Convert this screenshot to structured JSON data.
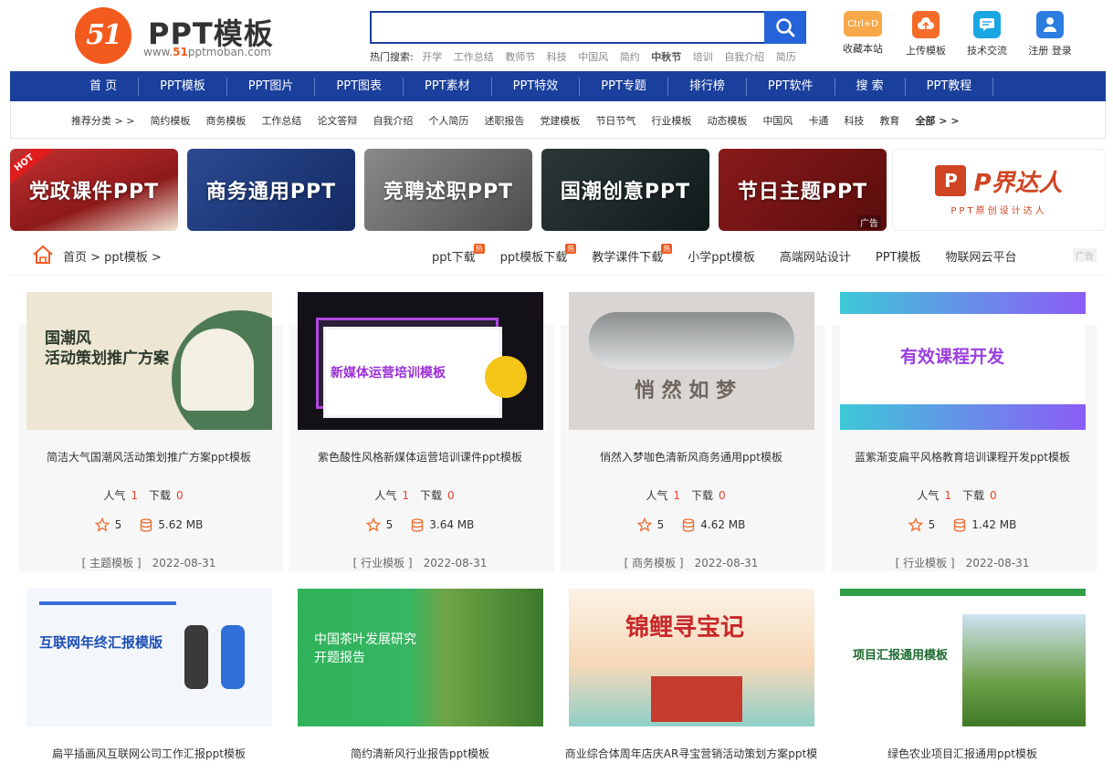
{
  "logo": {
    "badge": "51",
    "title": "PPT模板",
    "url_prefix": "www.",
    "url_brand": "51",
    "url_rest": "pptmoban.com"
  },
  "search": {
    "placeholder": "",
    "hot_label": "热门搜索:",
    "hot_terms": [
      "开学",
      "工作总结",
      "教师节",
      "科技",
      "中国风",
      "简约",
      "中秋节",
      "培训",
      "自我介绍",
      "简历"
    ]
  },
  "quick_links": [
    {
      "label": "收藏本站",
      "badge": "Ctrl+D",
      "icon": "bookmark-icon",
      "color": "#f7a94a"
    },
    {
      "label": "上传模板",
      "icon": "cloud-upload-icon",
      "color": "#f56b2a"
    },
    {
      "label": "技术交流",
      "icon": "chat-icon",
      "color": "#1aa6e0"
    },
    {
      "label": "注册 登录",
      "icon": "user-icon",
      "color": "#2b7de0"
    }
  ],
  "nav": [
    "首 页",
    "PPT模板",
    "PPT图片",
    "PPT图表",
    "PPT素材",
    "PPT特效",
    "PPT专题",
    "排行榜",
    "PPT软件",
    "搜 索",
    "PPT教程"
  ],
  "subnav": [
    "推荐分类 > >",
    "简约模板",
    "商务模板",
    "工作总结",
    "论文答辩",
    "自我介绍",
    "个人简历",
    "述职报告",
    "党建模板",
    "节日节气",
    "行业模板",
    "动态模板",
    "中国风",
    "卡通",
    "科技",
    "教育",
    "全部 > >"
  ],
  "banners": [
    {
      "text": "党政课件PPT",
      "ribbon": "HOT",
      "bg": "#a31f1f"
    },
    {
      "text": "商务通用PPT",
      "bg": "#1e3a7a"
    },
    {
      "text": "竞聘述职PPT",
      "bg": "#6d6d6d"
    },
    {
      "text": "国潮创意PPT",
      "bg": "#1f2a2a"
    },
    {
      "text": "节日主题PPT",
      "ad": "广告",
      "bg": "#7a1414"
    }
  ],
  "ad_banner": {
    "p": "P",
    "title": "P界达人",
    "sub": "PPT原创设计达人"
  },
  "breadcrumb": "首页 > ppt模板 >",
  "top_links": [
    {
      "text": "ppt下载",
      "hot": "热"
    },
    {
      "text": "ppt模板下载",
      "hot": "热"
    },
    {
      "text": "教学课件下载",
      "hot": "热"
    },
    {
      "text": "小学ppt模板"
    },
    {
      "text": "高端网站设计"
    },
    {
      "text": "PPT模板"
    },
    {
      "text": "物联网云平台"
    }
  ],
  "top_links_ad": "广告",
  "stats_labels": {
    "popularity": "人气",
    "downloads": "下载"
  },
  "cards": [
    {
      "name": "简洁大气国潮风活动策划推广方案ppt模板",
      "thumb_title": "国潮风\n活动策划推广方案",
      "popularity": "1",
      "downloads": "0",
      "rating": "5",
      "size": "5.62 MB",
      "category": "[ 主题模板 ]",
      "date": "2022-08-31"
    },
    {
      "name": "紫色酸性风格新媒体运营培训课件ppt模板",
      "thumb_title": "新媒体运营培训模板",
      "popularity": "1",
      "downloads": "0",
      "rating": "5",
      "size": "3.64 MB",
      "category": "[ 行业模板 ]",
      "date": "2022-08-31"
    },
    {
      "name": "悄然入梦咖色清新风商务通用ppt模板",
      "thumb_title": "悄 然 如 梦",
      "popularity": "1",
      "downloads": "0",
      "rating": "5",
      "size": "4.62 MB",
      "category": "[ 商务模板 ]",
      "date": "2022-08-31"
    },
    {
      "name": "蓝紫渐变扁平风格教育培训课程开发ppt模板",
      "thumb_title": "有效课程开发",
      "popularity": "1",
      "downloads": "0",
      "rating": "5",
      "size": "1.42 MB",
      "category": "[ 行业模板 ]",
      "date": "2022-08-31"
    },
    {
      "name": "扁平插画风互联网公司工作汇报ppt模板",
      "thumb_title": "互联网年终汇报模版"
    },
    {
      "name": "简约清新风行业报告ppt模板",
      "thumb_title": "中国茶叶发展研究\n开题报告"
    },
    {
      "name": "商业综合体周年店庆AR寻宝营销活动策划方案ppt模",
      "thumb_title": "锦鲤寻宝记"
    },
    {
      "name": "绿色农业项目汇报通用ppt模板",
      "thumb_title": "项目汇报通用模板"
    }
  ],
  "colors": {
    "nav_bg": "#1a3f9c",
    "search_btn": "#2563d8",
    "accent": "#f25a1e",
    "count_red": "#e8402a"
  }
}
